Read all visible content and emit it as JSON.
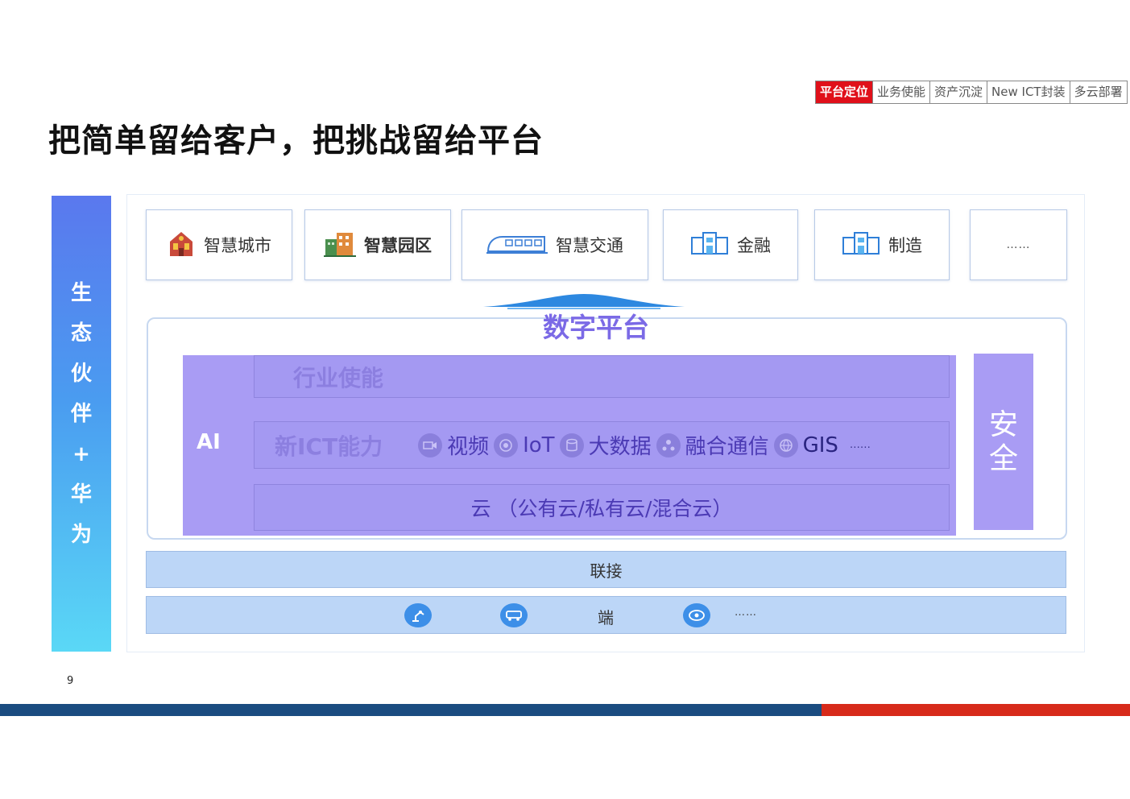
{
  "nav": {
    "tabs": [
      {
        "label": "平台定位",
        "active": true
      },
      {
        "label": "业务使能",
        "active": false
      },
      {
        "label": "资产沉淀",
        "active": false
      },
      {
        "label": "New ICT封装",
        "active": false
      },
      {
        "label": "多云部署",
        "active": false
      }
    ]
  },
  "title": "把简单留给客户，把挑战留给平台",
  "ecosystem": {
    "chars": [
      "生",
      "态",
      "伙",
      "伴",
      "+",
      "华",
      "为"
    ]
  },
  "scenarios": [
    {
      "label": "智慧城市",
      "icon": "city-building-icon"
    },
    {
      "label": "智慧园区",
      "icon": "park-building-icon"
    },
    {
      "label": "智慧交通",
      "icon": "train-icon"
    },
    {
      "label": "金融",
      "icon": "bank-building-icon"
    },
    {
      "label": "制造",
      "icon": "factory-building-icon"
    },
    {
      "label": "……"
    }
  ],
  "platform": {
    "title": "数字平台",
    "ai_label": "AI",
    "industry_layer": "行业使能",
    "ict_layer": {
      "title": "新ICT能力",
      "capabilities": [
        {
          "label": "视频",
          "icon": "video-icon"
        },
        {
          "label": "IoT",
          "icon": "iot-icon"
        },
        {
          "label": "大数据",
          "icon": "big-data-icon"
        },
        {
          "label": "融合通信",
          "icon": "communication-icon"
        },
        {
          "label": "GIS",
          "icon": "gis-icon"
        }
      ],
      "more": "……"
    },
    "cloud_layer": "云 （公有云/私有云/混合云）",
    "security": [
      "安",
      "全"
    ]
  },
  "connect_bar": "联接",
  "terminal_bar": {
    "label": "端",
    "icons": [
      "robot-arm-icon",
      "vehicle-icon",
      "camera-icon"
    ],
    "more": "……"
  },
  "page_number": "9",
  "colors": {
    "accent_red": "#e0101a",
    "ecosystem_top": "#5a78ee",
    "ecosystem_bottom": "#5ad8f6",
    "platform_purple": "#a99cf4",
    "platform_title": "#7b6ae6",
    "bar_blue": "#bcd6f7",
    "stripe_blue": "#1a4c80",
    "stripe_red": "#d72a1a"
  }
}
